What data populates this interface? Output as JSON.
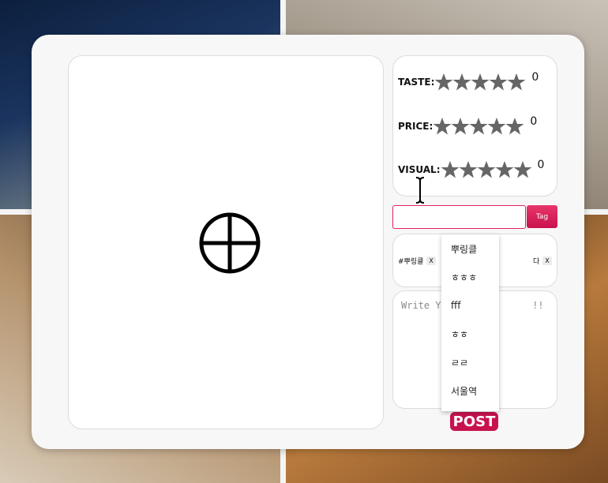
{
  "ratings": [
    {
      "label": "TASTE:",
      "value": "0"
    },
    {
      "label": "PRICE:",
      "value": "0"
    },
    {
      "label": "VISUAL:",
      "value": "0"
    }
  ],
  "tag_input": {
    "value": "",
    "button_label": "Tag"
  },
  "tags": [
    {
      "text": "#뿌링클",
      "remove": "X"
    },
    {
      "text": "다",
      "remove": "X"
    }
  ],
  "review": {
    "placeholder": "Write Y                !!"
  },
  "suggestions": [
    "뿌링클",
    "ㅎㅎㅎ",
    "fff",
    "ㅎㅎ",
    "ㄹㄹ",
    "서울역"
  ],
  "post_label": "POST",
  "colors": {
    "accent": "#e0245e",
    "star": "#666666",
    "card": "#f7f7f7"
  },
  "icons": {
    "add_photo": "circle-plus-icon",
    "star": "star-icon",
    "cursor": "text-cursor-icon"
  }
}
